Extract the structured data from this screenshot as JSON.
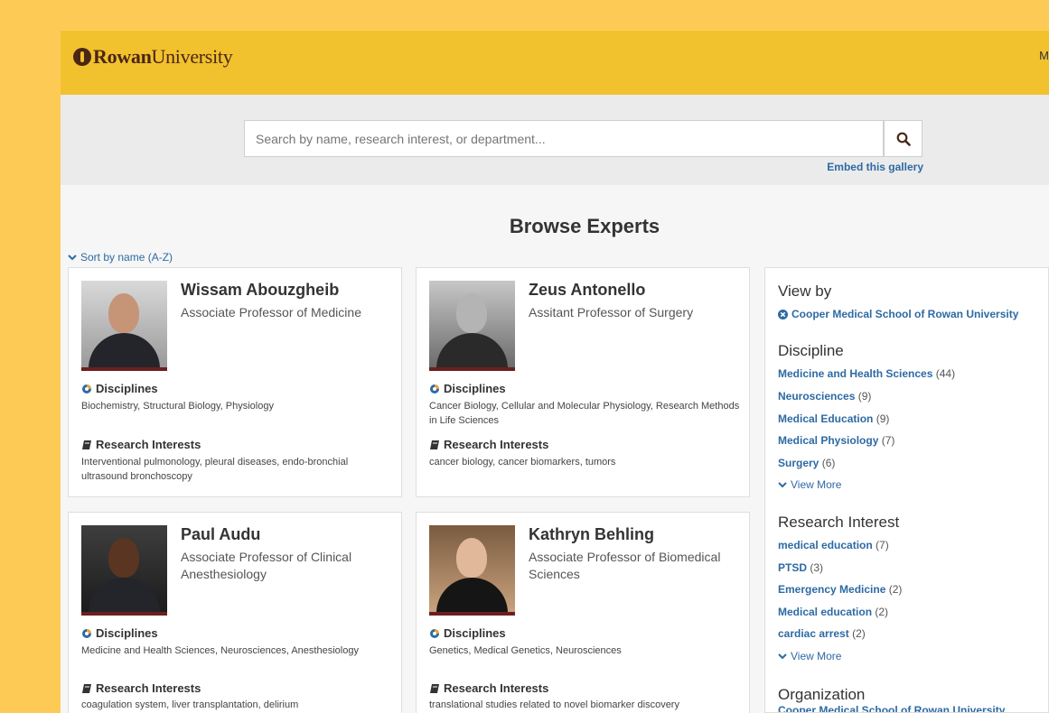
{
  "header": {
    "logo_bold": "Rowan",
    "logo_rest": "University",
    "right_text": "M"
  },
  "search": {
    "placeholder": "Search by name, research interest, or department...",
    "embed_link": "Embed this gallery"
  },
  "page_title": "Browse Experts",
  "sort_label": "Sort by name (A-Z)",
  "experts": [
    {
      "name": "Wissam Abouzgheib",
      "title": "Associate Professor of Medicine",
      "disciplines_label": "Disciplines",
      "disciplines": "Biochemistry, Structural Biology, Physiology",
      "interests_label": "Research Interests",
      "interests": "Interventional pulmonology, pleural diseases, endo-bronchial ultrasound bronchoscopy"
    },
    {
      "name": "Zeus Antonello",
      "title": "Assitant Professor of Surgery",
      "disciplines_label": "Disciplines",
      "disciplines": "Cancer Biology, Cellular and Molecular Physiology, Research Methods in Life Sciences",
      "interests_label": "Research Interests",
      "interests": "cancer biology, cancer biomarkers, tumors"
    },
    {
      "name": "Paul Audu",
      "title": "Associate Professor of Clinical Anesthesiology",
      "disciplines_label": "Disciplines",
      "disciplines": "Medicine and Health Sciences, Neurosciences, Anesthesiology",
      "interests_label": "Research Interests",
      "interests": "coagulation system, liver transplantation, delirium"
    },
    {
      "name": "Kathryn Behling",
      "title": "Associate Professor of Biomedical Sciences",
      "disciplines_label": "Disciplines",
      "disciplines": "Genetics, Medical Genetics, Neurosciences",
      "interests_label": "Research Interests",
      "interests": "translational studies related to novel biomarker discovery"
    }
  ],
  "sidebar": {
    "view_by": "View by",
    "active_filter": "Cooper Medical School of Rowan University",
    "discipline_heading": "Discipline",
    "disciplines": [
      {
        "label": "Medicine and Health Sciences",
        "count": "(44)"
      },
      {
        "label": "Neurosciences",
        "count": "(9)"
      },
      {
        "label": "Medical Education",
        "count": "(9)"
      },
      {
        "label": "Medical Physiology",
        "count": "(7)"
      },
      {
        "label": "Surgery",
        "count": "(6)"
      }
    ],
    "view_more": "View More",
    "interest_heading": "Research Interest",
    "interests": [
      {
        "label": "medical education",
        "count": "(7)"
      },
      {
        "label": "PTSD",
        "count": "(3)"
      },
      {
        "label": "Emergency Medicine",
        "count": "(2)"
      },
      {
        "label": "Medical education",
        "count": "(2)"
      },
      {
        "label": "cardiac arrest",
        "count": "(2)"
      }
    ],
    "organization_heading": "Organization",
    "organization_item": "Cooper Medical School of Rowan University"
  },
  "colors": {
    "page_bg": "#fdcb55",
    "header_bg": "#f2c12e",
    "link": "#2d6aa3",
    "brand_brown": "#4a2714"
  }
}
